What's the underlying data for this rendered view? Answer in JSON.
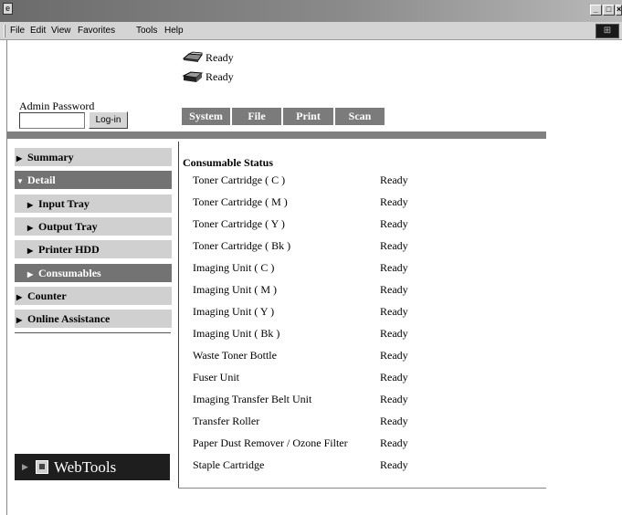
{
  "window": {
    "menus": [
      "File",
      "Edit",
      "View",
      "Favorites",
      "Tools",
      "Help"
    ],
    "controls": [
      "_",
      "□",
      "×"
    ]
  },
  "status": [
    "Ready",
    "Ready"
  ],
  "admin": {
    "label": "Admin Password",
    "password_value": "",
    "login_label": "Log-in"
  },
  "tabs": [
    "System",
    "File",
    "Print",
    "Scan"
  ],
  "nav": [
    {
      "label": "Summary",
      "arrow": "▶",
      "style": "light"
    },
    {
      "label": "Detail",
      "arrow": "▼",
      "style": "dark"
    },
    {
      "label": "Input Tray",
      "arrow": "▶",
      "style": "light"
    },
    {
      "label": "Output Tray",
      "arrow": "▶",
      "style": "light"
    },
    {
      "label": "Printer HDD",
      "arrow": "▶",
      "style": "light"
    },
    {
      "label": "Consumables",
      "arrow": "▶",
      "style": "dark"
    },
    {
      "label": "Counter",
      "arrow": "▶",
      "style": "light"
    },
    {
      "label": "Online Assistance",
      "arrow": "▶",
      "style": "light"
    }
  ],
  "logo": {
    "text": "WebTools"
  },
  "content": {
    "title": "Consumable Status",
    "rows": [
      {
        "name": "Toner Cartridge ( C )",
        "status": "Ready"
      },
      {
        "name": "Toner Cartridge ( M )",
        "status": "Ready"
      },
      {
        "name": "Toner Cartridge ( Y )",
        "status": "Ready"
      },
      {
        "name": "Toner Cartridge ( Bk )",
        "status": "Ready"
      },
      {
        "name": "Imaging Unit ( C )",
        "status": "Ready"
      },
      {
        "name": "Imaging Unit ( M )",
        "status": "Ready"
      },
      {
        "name": "Imaging Unit ( Y )",
        "status": "Ready"
      },
      {
        "name": "Imaging Unit ( Bk )",
        "status": "Ready"
      },
      {
        "name": "Waste Toner Bottle",
        "status": "Ready"
      },
      {
        "name": "Fuser Unit",
        "status": "Ready"
      },
      {
        "name": "Imaging Transfer Belt Unit",
        "status": "Ready"
      },
      {
        "name": "Transfer Roller",
        "status": "Ready"
      },
      {
        "name": "Paper Dust Remover / Ozone Filter",
        "status": "Ready"
      },
      {
        "name": "Staple Cartridge",
        "status": "Ready"
      }
    ]
  }
}
